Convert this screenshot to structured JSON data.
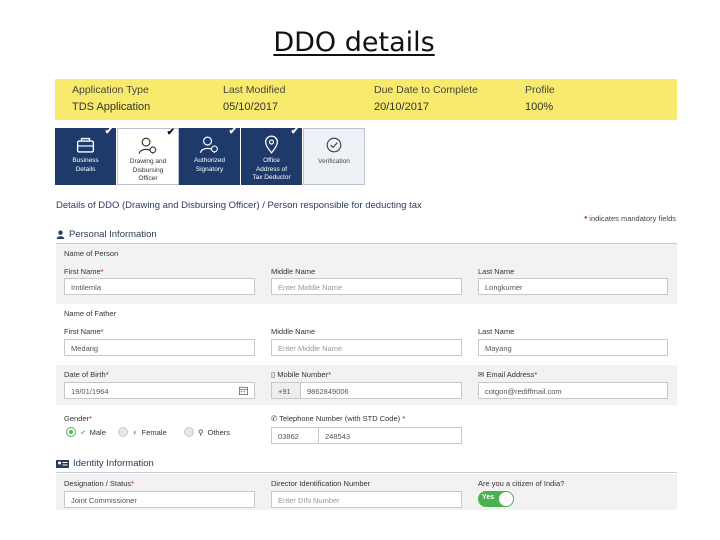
{
  "slide_title": "DDO details",
  "summary": [
    {
      "label": "Application Type",
      "value": "TDS Application"
    },
    {
      "label": "Last Modified",
      "value": "05/10/2017"
    },
    {
      "label": "Due Date to Complete",
      "value": "20/10/2017"
    },
    {
      "label": "Profile",
      "value": "100%"
    }
  ],
  "steps": [
    {
      "l1": "Business",
      "l2": "Details",
      "l3": "",
      "l4": "",
      "icon": "briefcase-icon",
      "completed": true
    },
    {
      "l1": "Drawing and",
      "l2": "Disbursing",
      "l3": "Officer",
      "l4": "",
      "icon": "user-gear-icon",
      "completed": true,
      "active": true
    },
    {
      "l1": "Authorized",
      "l2": "Signatory",
      "l3": "",
      "l4": "",
      "icon": "user-check-icon",
      "completed": true
    },
    {
      "l1": "Office",
      "l2": "Address of",
      "l3": "Tax Deductor",
      "l4": "",
      "icon": "location-pin-icon",
      "completed": true
    },
    {
      "l1": "Verification",
      "l2": "",
      "l3": "",
      "l4": "",
      "icon": "check-circle-icon",
      "completed": false
    }
  ],
  "details_heading": "Details of DDO (Drawing and Disbursing Officer) / Person responsible for deducting tax",
  "mandatory_star": "*",
  "mandatory_note": " indicates mandatory fields",
  "personal": {
    "heading": "Personal Information",
    "name_group_label": "Name of Person",
    "first_name_label": "First Name",
    "middle_name_label": "Middle Name",
    "last_name_label": "Last Name",
    "first_name": "Imtilemla",
    "middle_name_placeholder": "Enter Middle Name",
    "last_name": "Longkumer",
    "father_group_label": "Name of Father",
    "father_first_name": "Medang",
    "father_middle_placeholder": "Enter Middle Name",
    "father_last_name": "Mayang",
    "dob_label": "Date of Birth",
    "dob": "19/01/1964",
    "mobile_label": "Mobile Number",
    "mobile_code": "+91",
    "mobile": "9862849006",
    "email_label": "Email Address",
    "email": "cotgon@rediffmail.com",
    "gender_label": "Gender",
    "gender_options": [
      "Male",
      "Female",
      "Others"
    ],
    "gender_selected": "Male",
    "phone_label": "Telephone Number (with STD Code)",
    "std_code": "03862",
    "phone": "248543",
    "req": "*"
  },
  "identity": {
    "heading": "Identity Information",
    "designation_label": "Designation / Status",
    "designation": "Joint Commissioner",
    "din_label": "Director Identification Number",
    "din_placeholder": "Enter DIN Number",
    "citizen_label": "Are you a citizen of India?",
    "citizen_value": "Yes"
  },
  "colors": {
    "summary_bg": "#f8ea6c",
    "step_bg": "#1d3a6b",
    "required": "#d0021b",
    "toggle_on": "#4caf50"
  }
}
